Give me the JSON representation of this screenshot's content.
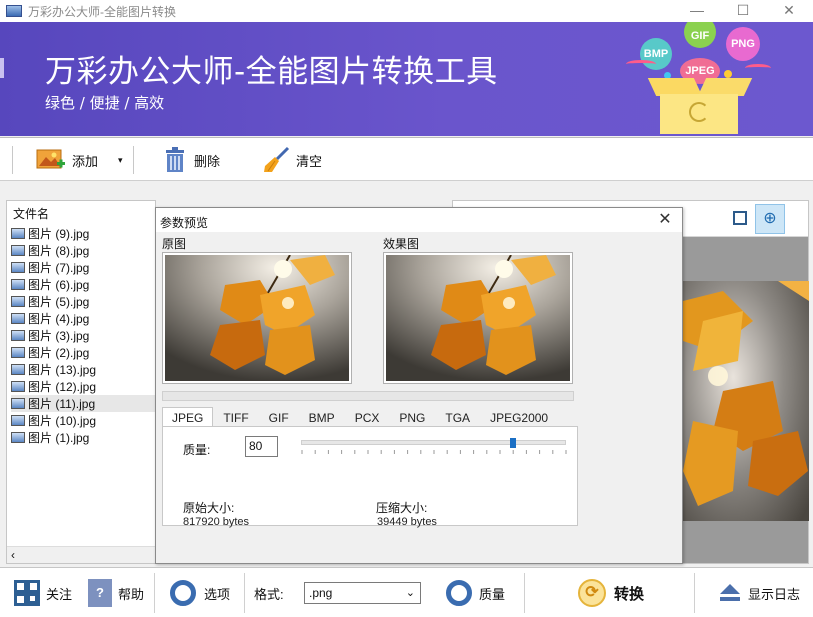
{
  "window": {
    "title": "万彩办公大师-全能图片转换",
    "minimize_icon": "minimize-icon",
    "maximize_icon": "maximize-icon",
    "close_icon": "close-icon"
  },
  "banner": {
    "title": "万彩办公大师-全能图片转换工具",
    "slogan": "绿色 / 便捷 / 高效",
    "badges": [
      "BMP",
      "GIF",
      "PNG",
      "JPEG"
    ]
  },
  "toolbar": {
    "add": "添加",
    "delete": "删除",
    "clear": "清空"
  },
  "file_list": {
    "column": "文件名",
    "files": [
      "图片 (9).jpg",
      "图片 (8).jpg",
      "图片 (7).jpg",
      "图片 (6).jpg",
      "图片 (5).jpg",
      "图片 (4).jpg",
      "图片 (3).jpg",
      "图片 (2).jpg",
      "图片 (13).jpg",
      "图片 (12).jpg",
      "图片 (11).jpg",
      "图片 (10).jpg",
      "图片 (1).jpg"
    ],
    "selected_index": 10
  },
  "dialog": {
    "title": "参数预览",
    "original_label": "原图",
    "effect_label": "效果图",
    "tabs": [
      "JPEG",
      "TIFF",
      "GIF",
      "BMP",
      "PCX",
      "PNG",
      "TGA",
      "JPEG2000"
    ],
    "active_tab": "JPEG",
    "quality_label": "质量:",
    "quality_value": "80",
    "quality_level": 0.8,
    "original_size_label": "原始大小:",
    "original_size": "817920 bytes",
    "compressed_size_label": "压缩大小:",
    "compressed_size": "39449 bytes"
  },
  "bottom": {
    "follow": "关注",
    "help": "帮助",
    "options": "选项",
    "format_label": "格式:",
    "format_value": ".png",
    "quality": "质量",
    "convert": "转换",
    "show_log": "显示日志"
  }
}
